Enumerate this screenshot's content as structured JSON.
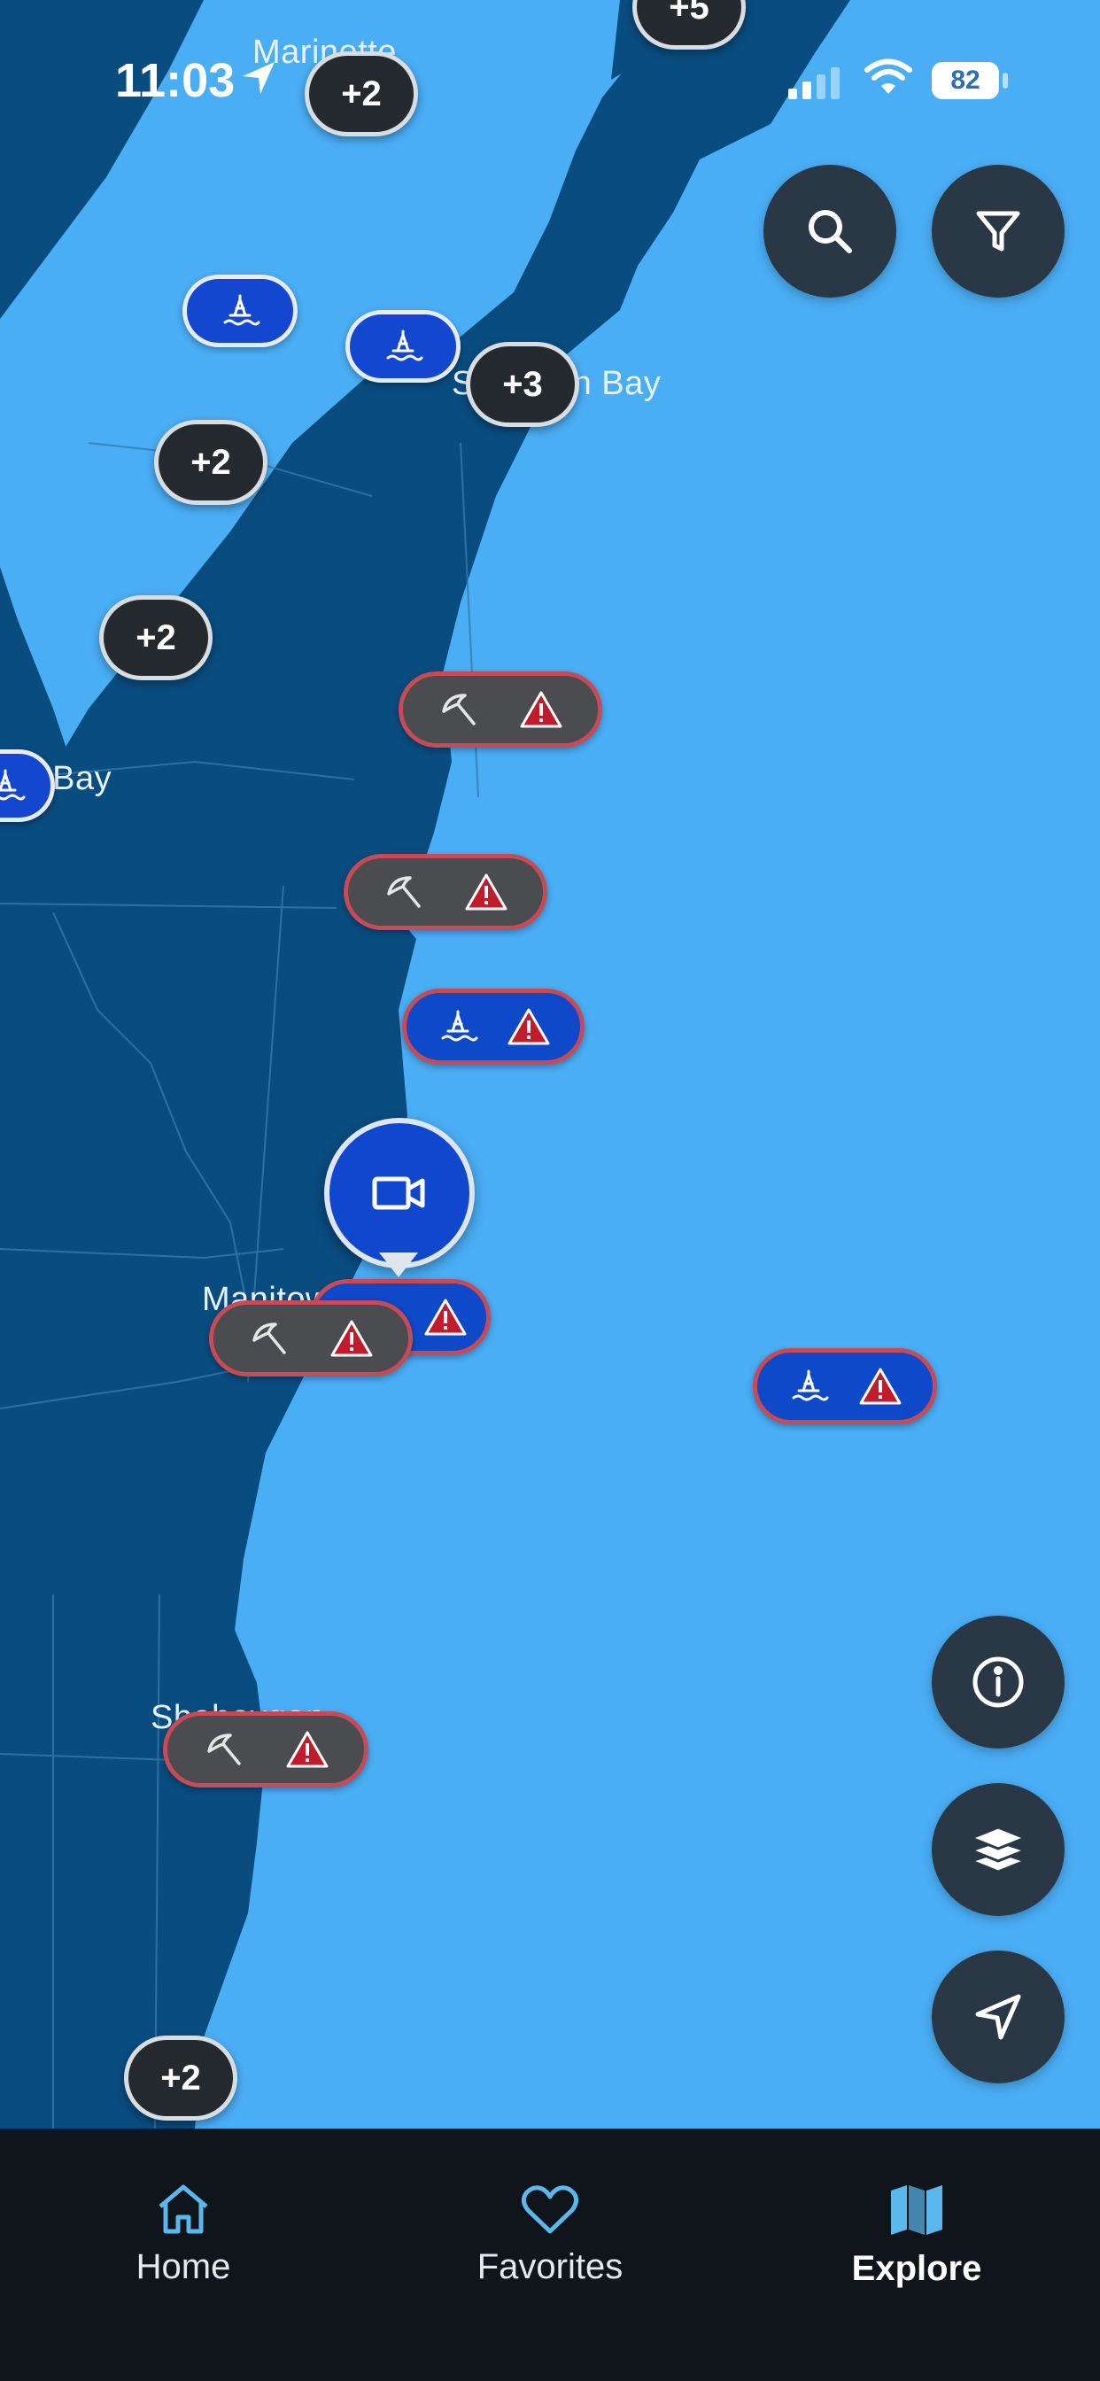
{
  "status_bar": {
    "time": "11:03",
    "battery": "82"
  },
  "map": {
    "place_labels": {
      "marinette": "Marinette",
      "sturgeon_bay": "Sturgeon Bay",
      "green_bay": "Green Bay",
      "manitowoc": "Manitowoc",
      "sheboygan": "Sheboygan"
    },
    "clusters": {
      "top": "+5",
      "marinette": "+2",
      "sturgeon_bay": "+3",
      "mid_bay": "+2",
      "lower_bay": "+2",
      "bottom": "+2"
    }
  },
  "buttons": {
    "search": "search-icon",
    "filter": "filter-icon",
    "info": "info-icon",
    "layers": "layers-icon",
    "locate": "navigation-arrow-icon"
  },
  "bottom_nav": {
    "home": "Home",
    "favorites": "Favorites",
    "explore": "Explore",
    "active": "Explore"
  },
  "colors": {
    "water": "#4aaef5",
    "land": "#094c7f",
    "marker_blue": "#0e49c9",
    "alert_red": "#c94a55",
    "nav_bg": "#10151b",
    "nav_icon": "#5bb8ec"
  }
}
